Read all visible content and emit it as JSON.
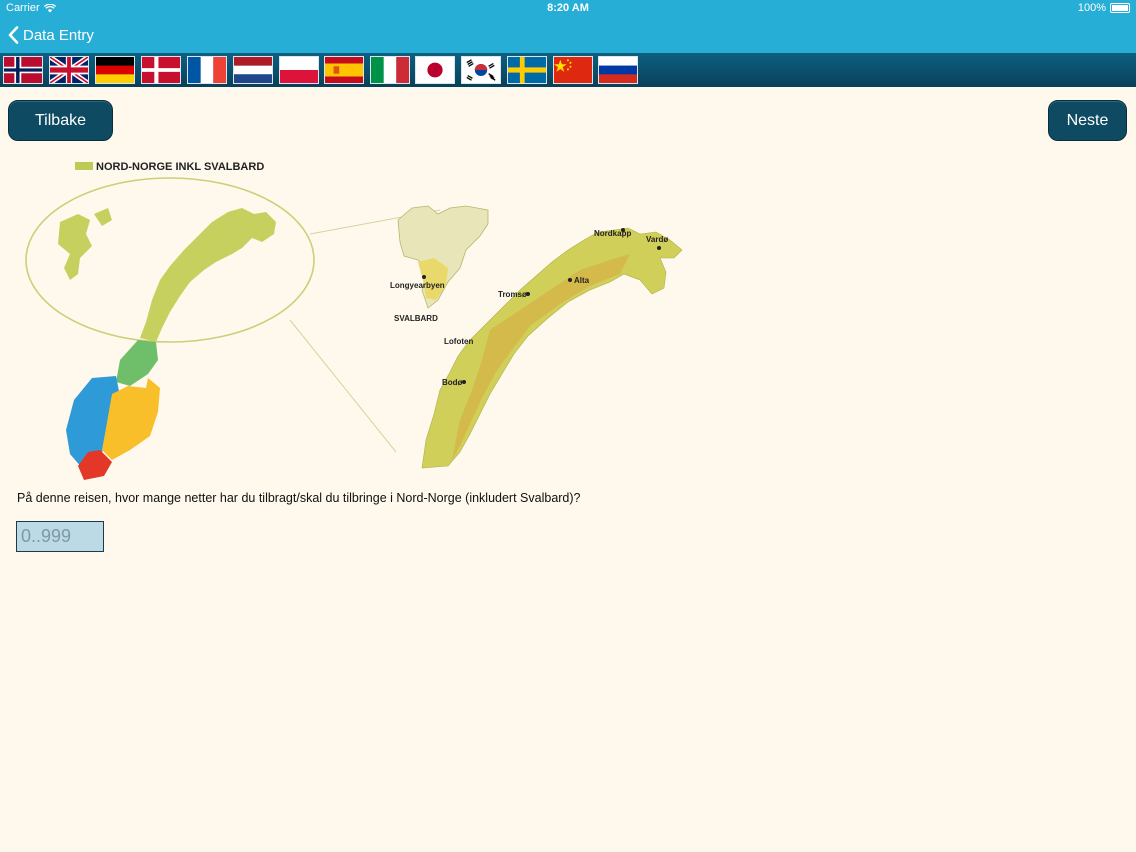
{
  "status_bar": {
    "carrier": "Carrier",
    "time": "8:20 AM",
    "battery": "100%"
  },
  "nav": {
    "back_label": "Data Entry"
  },
  "flags": [
    {
      "country": "Norway"
    },
    {
      "country": "United Kingdom"
    },
    {
      "country": "Germany"
    },
    {
      "country": "Denmark"
    },
    {
      "country": "France"
    },
    {
      "country": "Netherlands"
    },
    {
      "country": "Poland"
    },
    {
      "country": "Spain"
    },
    {
      "country": "Italy"
    },
    {
      "country": "Japan"
    },
    {
      "country": "South Korea"
    },
    {
      "country": "Sweden"
    },
    {
      "country": "China"
    },
    {
      "country": "Russia"
    }
  ],
  "buttons": {
    "back": "Tilbake",
    "next": "Neste"
  },
  "map": {
    "legend": "NORD-NORGE INKL SVALBARD",
    "places": {
      "nordkapp": "Nordkapp",
      "vardo": "Vardø",
      "longyearbyen": "Longyearbyen",
      "alta": "Alta",
      "tromso": "Tromsø",
      "svalbard": "SVALBARD",
      "lofoten": "Lofoten",
      "bodo": "Bodø"
    }
  },
  "question": {
    "text": "På denne reisen, hvor mange netter har du tilbragt/skal du tilbringe i Nord-Norge (inkludert Svalbard)?",
    "placeholder": "0..999",
    "value": ""
  }
}
